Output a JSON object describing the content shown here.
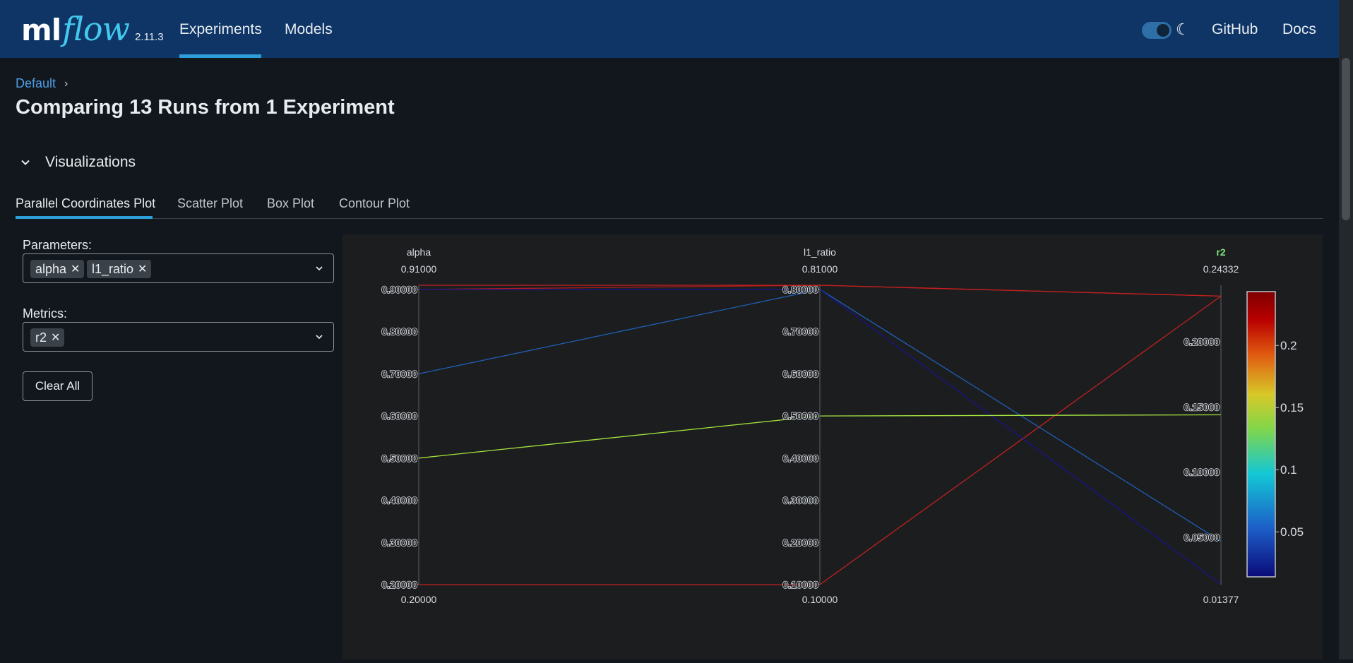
{
  "header": {
    "logo_ml": "ml",
    "logo_flow": "flow",
    "version": "2.11.3",
    "nav": [
      {
        "label": "Experiments",
        "active": true
      },
      {
        "label": "Models",
        "active": false
      }
    ],
    "theme_toggle": "on",
    "theme_icon": "moon-icon",
    "links": [
      "GitHub",
      "Docs"
    ],
    "background": "#0e3566",
    "accent": "#2e9ed8"
  },
  "breadcrumb": {
    "label": "Default"
  },
  "page": {
    "title": "Comparing 13 Runs from 1 Experiment"
  },
  "section": {
    "label": "Visualizations",
    "expanded": true
  },
  "tabs": [
    {
      "label": "Parallel Coordinates Plot",
      "active": true
    },
    {
      "label": "Scatter Plot",
      "active": false
    },
    {
      "label": "Box Plot",
      "active": false
    },
    {
      "label": "Contour Plot",
      "active": false
    }
  ],
  "controls": {
    "parameters_label": "Parameters:",
    "parameters": [
      "alpha",
      "l1_ratio"
    ],
    "metrics_label": "Metrics:",
    "metrics": [
      "r2"
    ],
    "clear_label": "Clear All"
  },
  "chart_data": {
    "type": "parallel-coordinates",
    "dimensions": [
      {
        "name": "alpha",
        "max_label": "0.91000",
        "min_label": "0.20000",
        "range": [
          0.2,
          0.91
        ],
        "ticks": [
          "0.90000",
          "0.80000",
          "0.70000",
          "0.60000",
          "0.50000",
          "0.40000",
          "0.30000",
          "0.20000"
        ],
        "tick_values": [
          0.9,
          0.8,
          0.7,
          0.6,
          0.5,
          0.4,
          0.3,
          0.2
        ]
      },
      {
        "name": "l1_ratio",
        "max_label": "0.81000",
        "min_label": "0.10000",
        "range": [
          0.1,
          0.81
        ],
        "ticks": [
          "0.80000",
          "0.70000",
          "0.60000",
          "0.50000",
          "0.40000",
          "0.30000",
          "0.20000",
          "0.10000"
        ],
        "tick_values": [
          0.8,
          0.7,
          0.6,
          0.5,
          0.4,
          0.3,
          0.2,
          0.1
        ]
      },
      {
        "name": "r2",
        "max_label": "0.24332",
        "min_label": "0.01377",
        "range": [
          0.01377,
          0.24332
        ],
        "ticks": [
          "0.20000",
          "0.15000",
          "0.10000",
          "0.05000"
        ],
        "tick_values": [
          0.2,
          0.15,
          0.1,
          0.05
        ],
        "highlight_color": "#7ee37e"
      }
    ],
    "lines": [
      {
        "alpha": 0.9,
        "l1_ratio": 0.81,
        "r2": 0.235,
        "color": "#b31b1b"
      },
      {
        "alpha": 0.91,
        "l1_ratio": 0.81,
        "r2": 0.235,
        "color": "#c42020"
      },
      {
        "alpha": 0.2,
        "l1_ratio": 0.1,
        "r2": 0.235,
        "color": "#c42020"
      },
      {
        "alpha": 0.7,
        "l1_ratio": 0.8,
        "r2": 0.047,
        "color": "#1f5fb5"
      },
      {
        "alpha": 0.9,
        "l1_ratio": 0.8,
        "r2": 0.014,
        "color": "#16158f"
      },
      {
        "alpha": 0.5,
        "l1_ratio": 0.5,
        "r2": 0.144,
        "color": "#a5e33f"
      }
    ],
    "colorbar": {
      "ticks": [
        "0.2",
        "0.15",
        "0.1",
        "0.05"
      ],
      "tick_values": [
        0.2,
        0.15,
        0.1,
        0.05
      ],
      "range": [
        0.01377,
        0.24332
      ],
      "colorscale": [
        "#0a0a78",
        "#1d5ec8",
        "#13c7d6",
        "#82d64a",
        "#d8c828",
        "#e05a10",
        "#b80000",
        "#7f0000"
      ]
    }
  }
}
